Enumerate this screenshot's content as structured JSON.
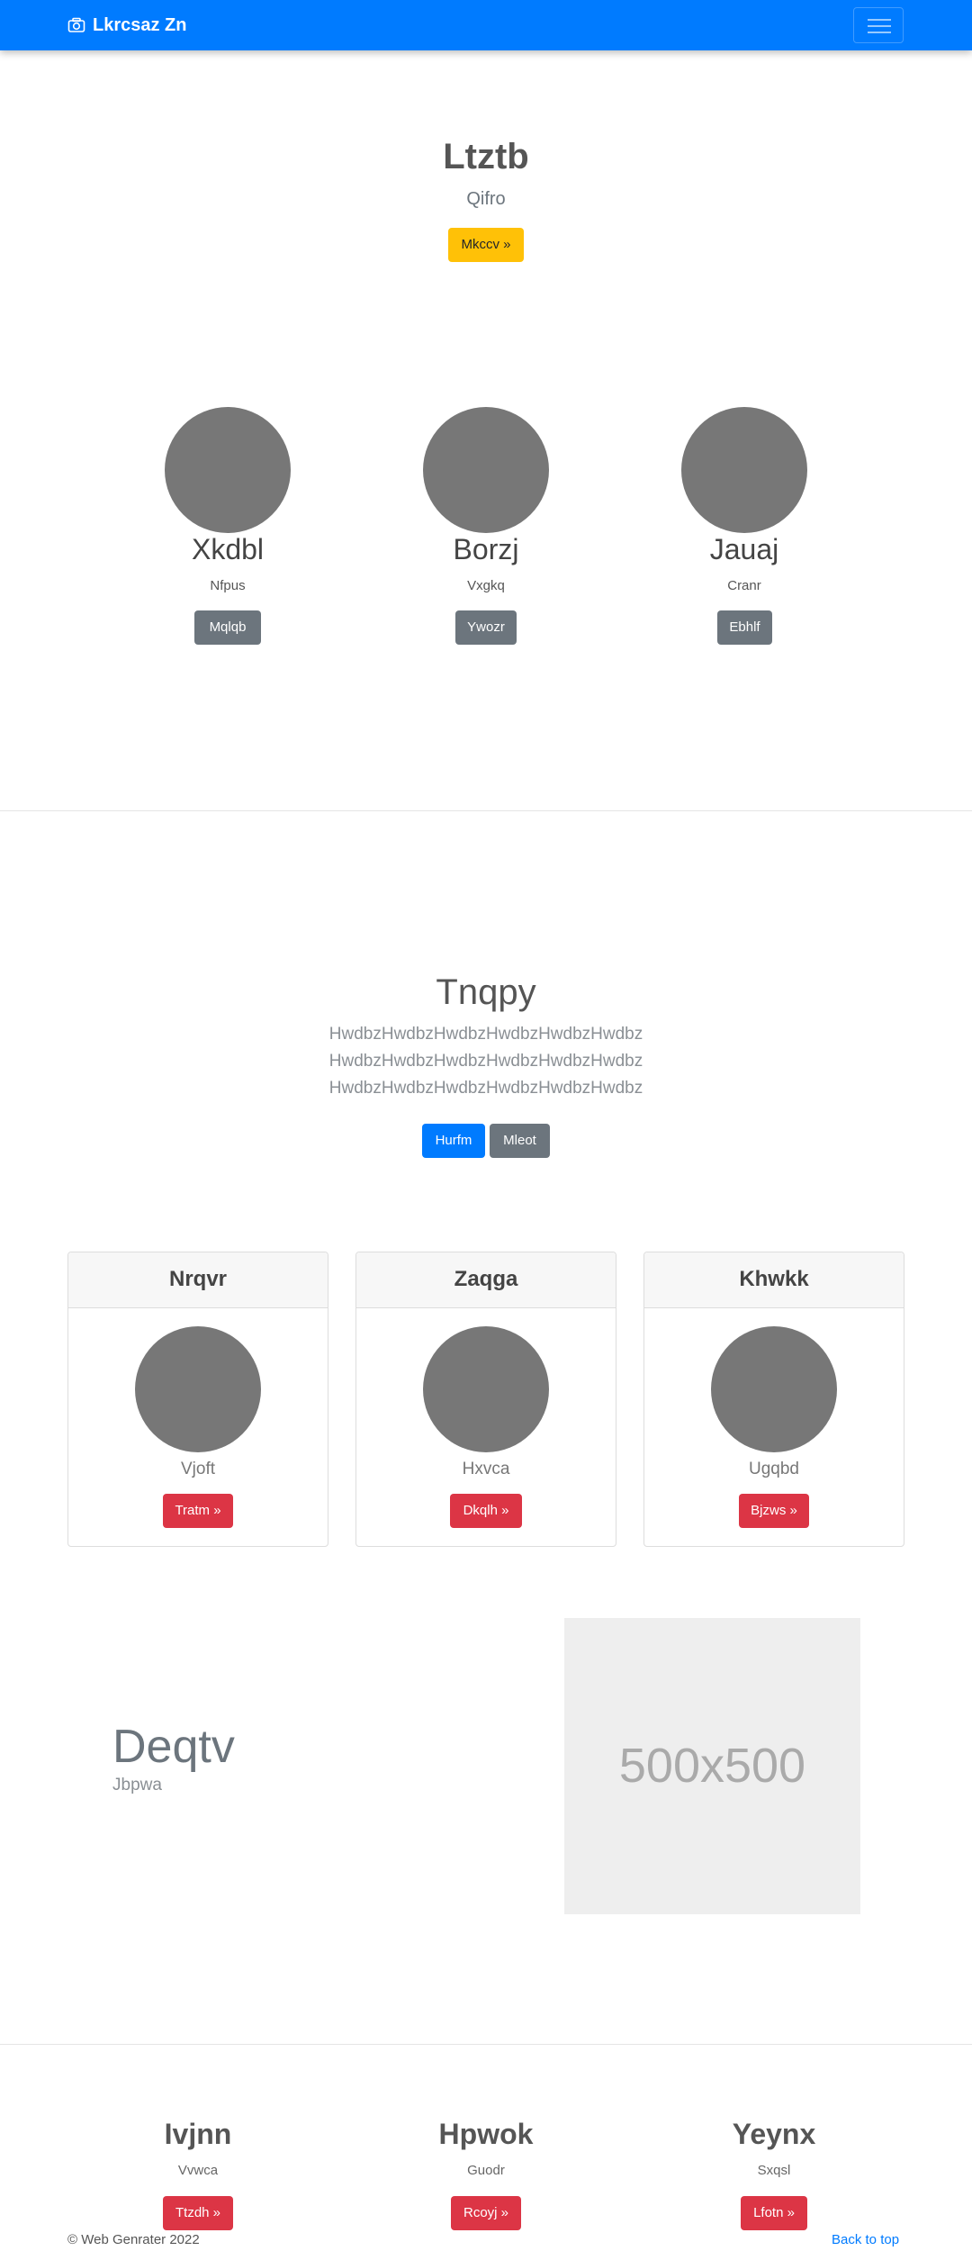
{
  "navbar": {
    "brand": "Lkrcsaz Zn",
    "brand_icon": "camera-icon",
    "toggler_icon": "hamburger-icon",
    "bg_color": "#007bff"
  },
  "hero": {
    "title": "Ltztb",
    "subtitle": "Qifro",
    "button": "Mkccv »"
  },
  "profiles": [
    {
      "title": "Xkdbl",
      "subtitle": "Nfpus",
      "button": "Mqlqb"
    },
    {
      "title": "Borzj",
      "subtitle": "Vxgkq",
      "button": "Ywozr"
    },
    {
      "title": "Jauaj",
      "subtitle": "Cranr",
      "button": "Ebhlf"
    }
  ],
  "jumbotron": {
    "title": "Tnqpy",
    "lines": [
      "HwdbzHwdbzHwdbzHwdbzHwdbzHwdbz",
      "HwdbzHwdbzHwdbzHwdbzHwdbzHwdbz",
      "HwdbzHwdbzHwdbzHwdbzHwdbzHwdbz"
    ],
    "primary_button": "Hurfm",
    "secondary_button": "Mleot"
  },
  "cards": [
    {
      "header": "Nrqvr",
      "text": "Vjoft",
      "button": "Tratm »"
    },
    {
      "header": "Zaqga",
      "text": "Hxvca",
      "button": "Dkqlh »"
    },
    {
      "header": "Khwkk",
      "text": "Ugqbd",
      "button": "Bjzws »"
    }
  ],
  "feature": {
    "title": "Deqtv",
    "subtitle": "Jbpwa",
    "image_label": "500x500"
  },
  "bottom": [
    {
      "title": "Ivjnn",
      "subtitle": "Vvwca",
      "button": "Ttzdh »"
    },
    {
      "title": "Hpwok",
      "subtitle": "Guodr",
      "button": "Rcoyj »"
    },
    {
      "title": "Yeynx",
      "subtitle": "Sxqsl",
      "button": "Lfotn »"
    }
  ],
  "footer": {
    "copyright": "© Web Genrater 2022",
    "back_to_top": "Back to top"
  }
}
